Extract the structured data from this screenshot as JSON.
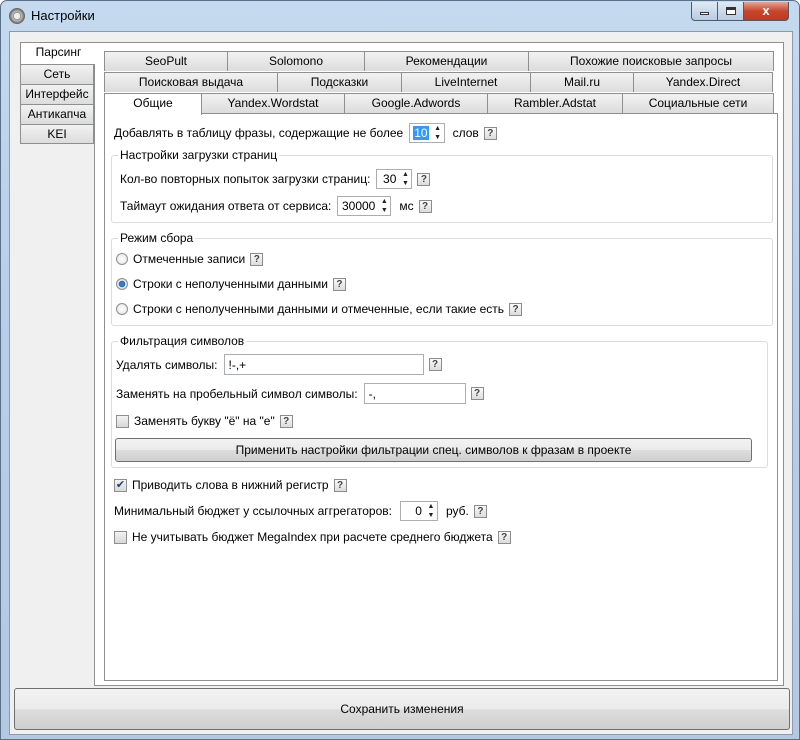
{
  "window": {
    "title": "Настройки",
    "min_glyph": "",
    "max_glyph": "",
    "close_glyph": "x"
  },
  "left_tabs": [
    "Парсинг",
    "Сеть",
    "Интерфейс",
    "Антикапча",
    "KEI"
  ],
  "top_tabs": {
    "row1": [
      "SeoPult",
      "Solomono",
      "Рекомендации",
      "Похожие поисковые запросы"
    ],
    "row2": [
      "Поисковая выдача",
      "Подсказки",
      "LiveInternet",
      "Mail.ru",
      "Yandex.Direct"
    ],
    "row3": [
      "Общие",
      "Yandex.Wordstat",
      "Google.Adwords",
      "Rambler.Adstat",
      "Социальные сети"
    ]
  },
  "form": {
    "add_phrases_label": "Добавлять в таблицу фразы, содержащие не более",
    "add_phrases_value": "10",
    "add_phrases_unit": "слов",
    "help": "?",
    "page_load": {
      "title": "Настройки загрузки страниц",
      "retries_label": "Кол-во повторных попыток загрузки страниц:",
      "retries_value": "30",
      "timeout_label": "Таймаут ожидания ответа от сервиса:",
      "timeout_value": "30000",
      "timeout_unit": "мс"
    },
    "collect_mode": {
      "title": "Режим сбора",
      "options": [
        "Отмеченные записи",
        "Строки с неполученными данными",
        "Строки с неполученными данными и отмеченные, если такие есть"
      ],
      "selected": "Строки с неполученными данными"
    },
    "filter": {
      "title": "Фильтрация символов",
      "remove_label": "Удалять символы:",
      "remove_value": "!-,+",
      "replace_label": "Заменять на пробельный символ символы:",
      "replace_value": "-,",
      "yo_label": "Заменять букву \"ё\" на \"е\"",
      "yo_checked": false,
      "apply_button": "Применить настройки фильтрации спец. символов к фразам в проекте"
    },
    "lowercase_label": "Приводить слова в нижний регистр",
    "lowercase_checked": true,
    "min_budget_label": "Минимальный бюджет у ссылочных аггрегаторов:",
    "min_budget_value": "0",
    "min_budget_unit": "руб.",
    "ignore_megaindex_label": "Не учитывать бюджет MegaIndex при расчете среднего бюджета",
    "ignore_megaindex_checked": false
  },
  "save_button": "Сохранить изменения",
  "spin_up": "▲",
  "spin_down": "▼",
  "check_mark": "✔"
}
